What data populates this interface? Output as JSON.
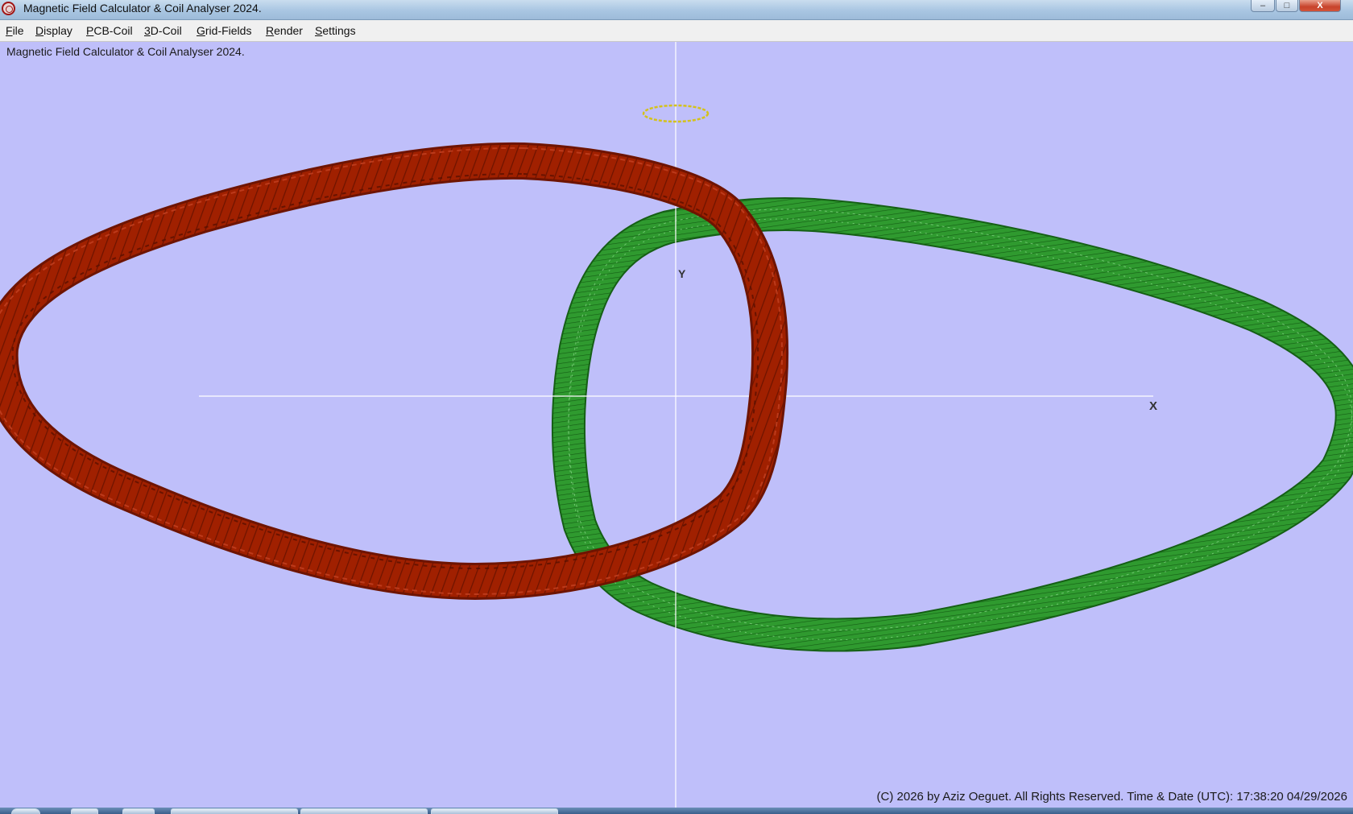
{
  "window": {
    "title": "Magnetic Field Calculator & Coil Analyser 2024.",
    "controls": {
      "minimize": "–",
      "maximize": "□",
      "close": "X"
    }
  },
  "menu": {
    "items": [
      {
        "accel": "F",
        "rest": "ile"
      },
      {
        "accel": "D",
        "rest": "isplay"
      },
      {
        "accel": "P",
        "rest": "CB-Coil"
      },
      {
        "accel": "3",
        "rest": "D-Coil"
      },
      {
        "accel": "G",
        "rest": "rid-Fields"
      },
      {
        "accel": "R",
        "rest": "ender"
      },
      {
        "accel": "S",
        "rest": "ettings"
      }
    ]
  },
  "viewport": {
    "caption": "Magnetic Field Calculator & Coil Analyser 2024.",
    "axis_x_label": "X",
    "axis_y_label": "Y",
    "footer": "(C) 2026  by Aziz Oeguet. All Rights Reserved.  Time & Date (UTC): 17:38:20  04/29/2026",
    "colors": {
      "background": "#bfbffa",
      "coil_red": "#a02000",
      "coil_red_dark": "#6e1400",
      "coil_green": "#238c23",
      "coil_green_dark": "#125c12",
      "axis": "#ffffff",
      "small_coil": "#d4c21a"
    }
  }
}
